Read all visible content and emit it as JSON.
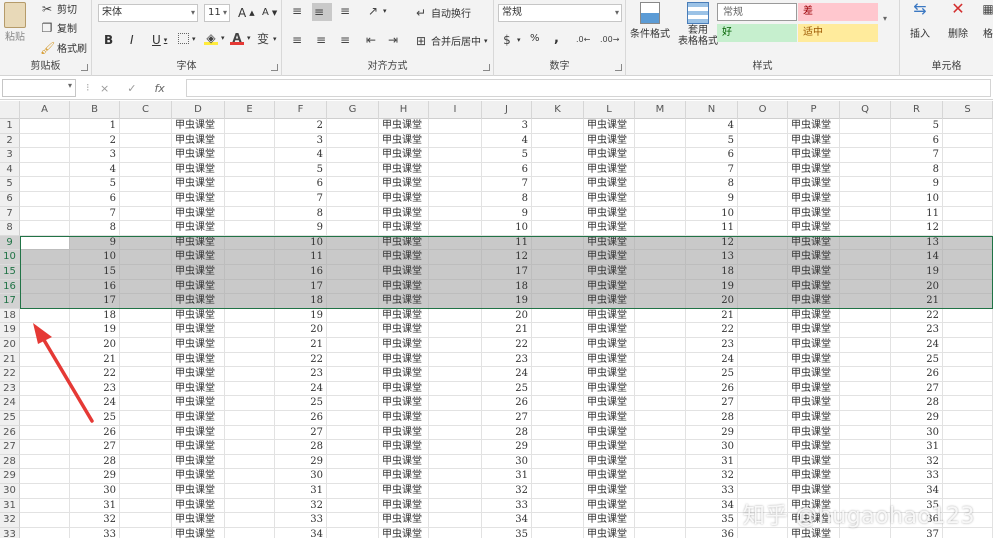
{
  "ribbon": {
    "clipboard": {
      "label": "剪贴板",
      "paste": "粘贴",
      "cut": "剪切",
      "copy": "复制",
      "format_painter": "格式刷"
    },
    "font": {
      "label": "字体",
      "name": "宋体",
      "size": "11",
      "grow": "A",
      "shrink": "A",
      "bold": "B",
      "italic": "I",
      "underline": "U",
      "wen": "变"
    },
    "alignment": {
      "label": "对齐方式",
      "wrap": "自动换行",
      "merge": "合并后居中"
    },
    "number": {
      "label": "数字",
      "format": "常规",
      "percent": "%",
      "comma": ","
    },
    "styles": {
      "label": "样式",
      "conditional": "条件格式",
      "table_format": "套用\n表格格式",
      "normal": "常规",
      "bad": "差",
      "good": "好",
      "neutral": "适中"
    },
    "cells": {
      "label": "单元格",
      "insert": "插入",
      "delete": "删除",
      "format": "格"
    }
  },
  "formula_bar": {
    "name_box": "",
    "cancel": "×",
    "enter": "✓",
    "fx": "fx",
    "content": ""
  },
  "columns": [
    "A",
    "B",
    "C",
    "D",
    "E",
    "F",
    "G",
    "H",
    "I",
    "J",
    "K",
    "L",
    "M",
    "N",
    "O",
    "P",
    "Q",
    "R",
    "S"
  ],
  "cell_text": "甲虫课堂",
  "rows": [
    {
      "h": "1",
      "b": "1",
      "f": "2",
      "j": "3",
      "n": "4",
      "r": "5"
    },
    {
      "h": "2",
      "b": "2",
      "f": "3",
      "j": "4",
      "n": "5",
      "r": "6"
    },
    {
      "h": "3",
      "b": "3",
      "f": "4",
      "j": "5",
      "n": "6",
      "r": "7"
    },
    {
      "h": "4",
      "b": "4",
      "f": "5",
      "j": "6",
      "n": "7",
      "r": "8"
    },
    {
      "h": "5",
      "b": "5",
      "f": "6",
      "j": "7",
      "n": "8",
      "r": "9"
    },
    {
      "h": "6",
      "b": "6",
      "f": "7",
      "j": "8",
      "n": "9",
      "r": "10"
    },
    {
      "h": "7",
      "b": "7",
      "f": "8",
      "j": "9",
      "n": "10",
      "r": "11"
    },
    {
      "h": "8",
      "b": "8",
      "f": "9",
      "j": "10",
      "n": "11",
      "r": "12"
    },
    {
      "h": "9",
      "b": "9",
      "f": "10",
      "j": "11",
      "n": "12",
      "r": "13",
      "sel": true
    },
    {
      "h": "10",
      "b": "10",
      "f": "11",
      "j": "12",
      "n": "13",
      "r": "14",
      "sel": true
    },
    {
      "h": "15",
      "b": "15",
      "f": "16",
      "j": "17",
      "n": "18",
      "r": "19",
      "sel": true
    },
    {
      "h": "16",
      "b": "16",
      "f": "17",
      "j": "18",
      "n": "19",
      "r": "20",
      "sel": true
    },
    {
      "h": "17",
      "b": "17",
      "f": "18",
      "j": "19",
      "n": "20",
      "r": "21",
      "sel": true
    },
    {
      "h": "18",
      "b": "18",
      "f": "19",
      "j": "20",
      "n": "21",
      "r": "22"
    },
    {
      "h": "19",
      "b": "19",
      "f": "20",
      "j": "21",
      "n": "22",
      "r": "23"
    },
    {
      "h": "20",
      "b": "20",
      "f": "21",
      "j": "22",
      "n": "23",
      "r": "24"
    },
    {
      "h": "21",
      "b": "21",
      "f": "22",
      "j": "23",
      "n": "24",
      "r": "25"
    },
    {
      "h": "22",
      "b": "22",
      "f": "23",
      "j": "24",
      "n": "25",
      "r": "26"
    },
    {
      "h": "23",
      "b": "23",
      "f": "24",
      "j": "25",
      "n": "26",
      "r": "27"
    },
    {
      "h": "24",
      "b": "24",
      "f": "25",
      "j": "26",
      "n": "27",
      "r": "28"
    },
    {
      "h": "25",
      "b": "25",
      "f": "26",
      "j": "27",
      "n": "28",
      "r": "29"
    },
    {
      "h": "26",
      "b": "26",
      "f": "27",
      "j": "28",
      "n": "29",
      "r": "30"
    },
    {
      "h": "27",
      "b": "27",
      "f": "28",
      "j": "29",
      "n": "30",
      "r": "31"
    },
    {
      "h": "28",
      "b": "28",
      "f": "29",
      "j": "30",
      "n": "31",
      "r": "32"
    },
    {
      "h": "29",
      "b": "29",
      "f": "30",
      "j": "31",
      "n": "32",
      "r": "33"
    },
    {
      "h": "30",
      "b": "30",
      "f": "31",
      "j": "32",
      "n": "33",
      "r": "34"
    },
    {
      "h": "31",
      "b": "31",
      "f": "32",
      "j": "33",
      "n": "34",
      "r": "35"
    },
    {
      "h": "32",
      "b": "32",
      "f": "33",
      "j": "34",
      "n": "35",
      "r": "36"
    },
    {
      "h": "33",
      "b": "33",
      "f": "34",
      "j": "35",
      "n": "36",
      "r": "37"
    }
  ],
  "watermark": "知乎 @hugaohao123",
  "colors": {
    "selection": "#c9c9c9",
    "accent": "#217346",
    "arrow": "#e53935",
    "bad_bg": "#ffc7ce",
    "good_bg": "#c6efce",
    "neutral_bg": "#ffeb9c"
  }
}
